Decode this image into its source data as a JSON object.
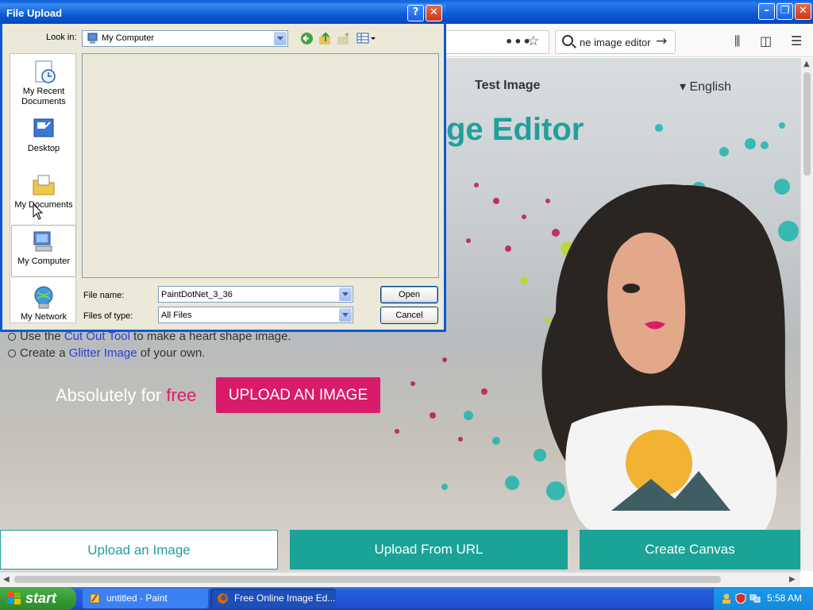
{
  "taskbar": {
    "start_label": "start",
    "items": [
      "untitled - Paint",
      "Free Online Image Ed..."
    ],
    "clock": "5:58 AM"
  },
  "browser": {
    "search_text": "ne image editor",
    "page": {
      "nav_test_image": "Test Image",
      "nav_language": "English",
      "title_partial": "ge Editor",
      "bullet1_pre": "Use the ",
      "bullet1_link": "Cut Out Tool",
      "bullet1_post": " to make a heart shape image.",
      "bullet2_pre": "Create a ",
      "bullet2_link": "Glitter Image",
      "bullet2_post": " of your own.",
      "free_pre": "Absolutely for ",
      "free_word": "free",
      "upload_button": "UPLOAD AN IMAGE",
      "bottom_buttons": [
        "Upload an Image",
        "Upload From URL",
        "Create Canvas"
      ]
    },
    "colors": {
      "teal": "#1aa396",
      "pink": "#d81b6a"
    }
  },
  "dialog": {
    "title": "File Upload",
    "look_in_label": "Look in:",
    "look_in_value": "My Computer",
    "places": [
      "My Recent Documents",
      "Desktop",
      "My Documents",
      "My Computer",
      "My Network"
    ],
    "selected_place": "My Computer",
    "file_name_label": "File name:",
    "file_name_value": "PaintDotNet_3_36",
    "file_type_label": "Files of type:",
    "file_type_value": "All Files",
    "open_button": "Open",
    "cancel_button": "Cancel"
  }
}
